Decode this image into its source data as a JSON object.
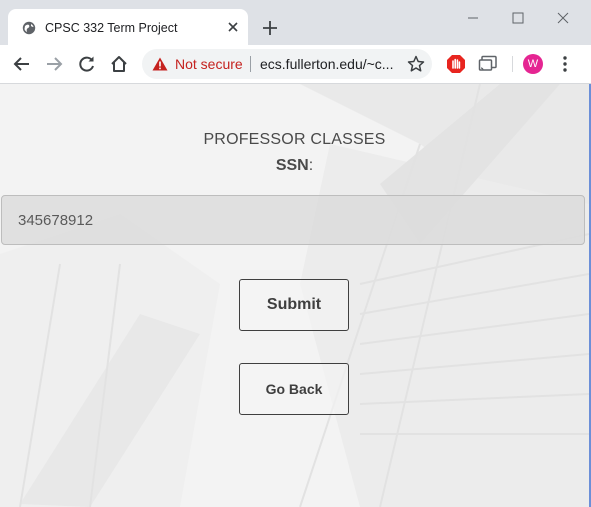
{
  "browser": {
    "tab_title": "CPSC 332 Term Project",
    "not_secure_label": "Not secure",
    "url": "ecs.fullerton.edu/~c...",
    "avatar_letter": "W",
    "avatar_color": "#e52592",
    "warning_color": "#c5221f",
    "icons": [
      "globe-icon",
      "close-icon",
      "plus-icon",
      "minimize-icon",
      "maximize-icon",
      "window-close-icon",
      "back-icon",
      "forward-icon",
      "reload-icon",
      "home-icon",
      "warning-icon",
      "star-icon",
      "adblock-stop-icon",
      "cast-icon",
      "kebab-menu-icon"
    ]
  },
  "page": {
    "heading": "PROFESSOR CLASSES",
    "ssn_label": "SSN",
    "ssn_colon": ":",
    "ssn_value": "345678912",
    "submit_label": "Submit",
    "back_label": "Go Back"
  }
}
